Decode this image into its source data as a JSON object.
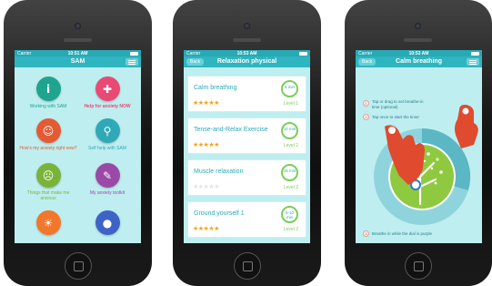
{
  "colors": {
    "accent": "#2fb5c0",
    "screen_bg": "#bfeef0",
    "title_teal": "#2aaab8",
    "level_green": "#7ccd5b",
    "star_orange": "#f6a21c",
    "finger_red": "#e04a2e"
  },
  "status_bar": {
    "carrier": "Carrier",
    "time1": "10:51 AM",
    "time2": "10:53 AM",
    "time3": "10:53 AM"
  },
  "screen1": {
    "title": "SAM",
    "menu_icon": "hamburger-menu-icon",
    "items": [
      {
        "label": "Working with SAM",
        "color": "#1fa58f",
        "icon": "info-icon"
      },
      {
        "label": "Help for anxiety NOW",
        "color": "#e94a74",
        "icon": "lifebuoy-icon"
      },
      {
        "label": "How's my anxiety right now?",
        "color": "#e45a33",
        "icon": "face-icon"
      },
      {
        "label": "Self help with SAM",
        "color": "#2fa9b8",
        "icon": "magnifier-icon"
      },
      {
        "label": "Things that make me anxious",
        "color": "#79b43a",
        "icon": "face-icon"
      },
      {
        "label": "My anxiety toolkit",
        "color": "#9a4aa6",
        "icon": "wrench-icon"
      },
      {
        "label": "",
        "color": "#f2772a",
        "icon": "sun-icon"
      },
      {
        "label": "",
        "color": "#3e63c6",
        "icon": "people-icon"
      }
    ]
  },
  "screen2": {
    "back": "Back",
    "title": "Relaxation physical",
    "items": [
      {
        "title": "Calm breathing",
        "duration": "5 min",
        "level": "Level 1",
        "stars": 5
      },
      {
        "title": "Tense-and-Relax Exercise",
        "duration": "10 min",
        "level": "Level 2",
        "stars": 5
      },
      {
        "title": "Muscle relaxation",
        "duration": "15 min",
        "level": "Level 2",
        "stars": 0
      },
      {
        "title": "Ground yourself 1",
        "duration": "5-10 min",
        "level": "Level 2",
        "stars": 5
      }
    ]
  },
  "screen3": {
    "back": "Back",
    "title": "Calm breathing",
    "instructions": [
      {
        "num": "1",
        "text": "Tap or drag to set breathe-in time (optional)"
      },
      {
        "num": "2",
        "text": "Tap once to start the timer"
      },
      {
        "num": "3",
        "text": "Breathe in while the dial is purple"
      }
    ]
  }
}
